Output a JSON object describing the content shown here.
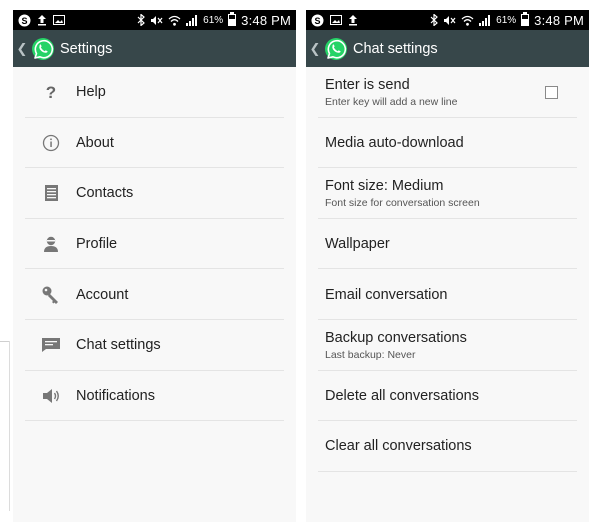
{
  "left_phone": {
    "status_bar": {
      "battery": "61%",
      "time": "3:48 PM"
    },
    "title": "Settings",
    "items": [
      {
        "label": "Help",
        "icon": "help-icon"
      },
      {
        "label": "About",
        "icon": "info-icon"
      },
      {
        "label": "Contacts",
        "icon": "contacts-icon"
      },
      {
        "label": "Profile",
        "icon": "profile-icon"
      },
      {
        "label": "Account",
        "icon": "key-icon"
      },
      {
        "label": "Chat settings",
        "icon": "chat-icon"
      },
      {
        "label": "Notifications",
        "icon": "speaker-icon"
      }
    ]
  },
  "right_phone": {
    "status_bar": {
      "battery": "61%",
      "time": "3:48 PM"
    },
    "title": "Chat settings",
    "items": [
      {
        "title": "Enter is send",
        "subtitle": "Enter key will add a new line",
        "checked": false
      },
      {
        "title": "Media auto-download"
      },
      {
        "title": "Font size: Medium",
        "subtitle": "Font size for conversation screen"
      },
      {
        "title": "Wallpaper"
      },
      {
        "title": "Email conversation"
      },
      {
        "title": "Backup conversations",
        "subtitle": "Last backup: Never"
      },
      {
        "title": "Delete all conversations"
      },
      {
        "title": "Clear all conversations"
      }
    ]
  },
  "colors": {
    "action_bar": "#37474a",
    "status_bar": "#000000",
    "whatsapp_green": "#25d366",
    "background": "#f8f8f8"
  }
}
